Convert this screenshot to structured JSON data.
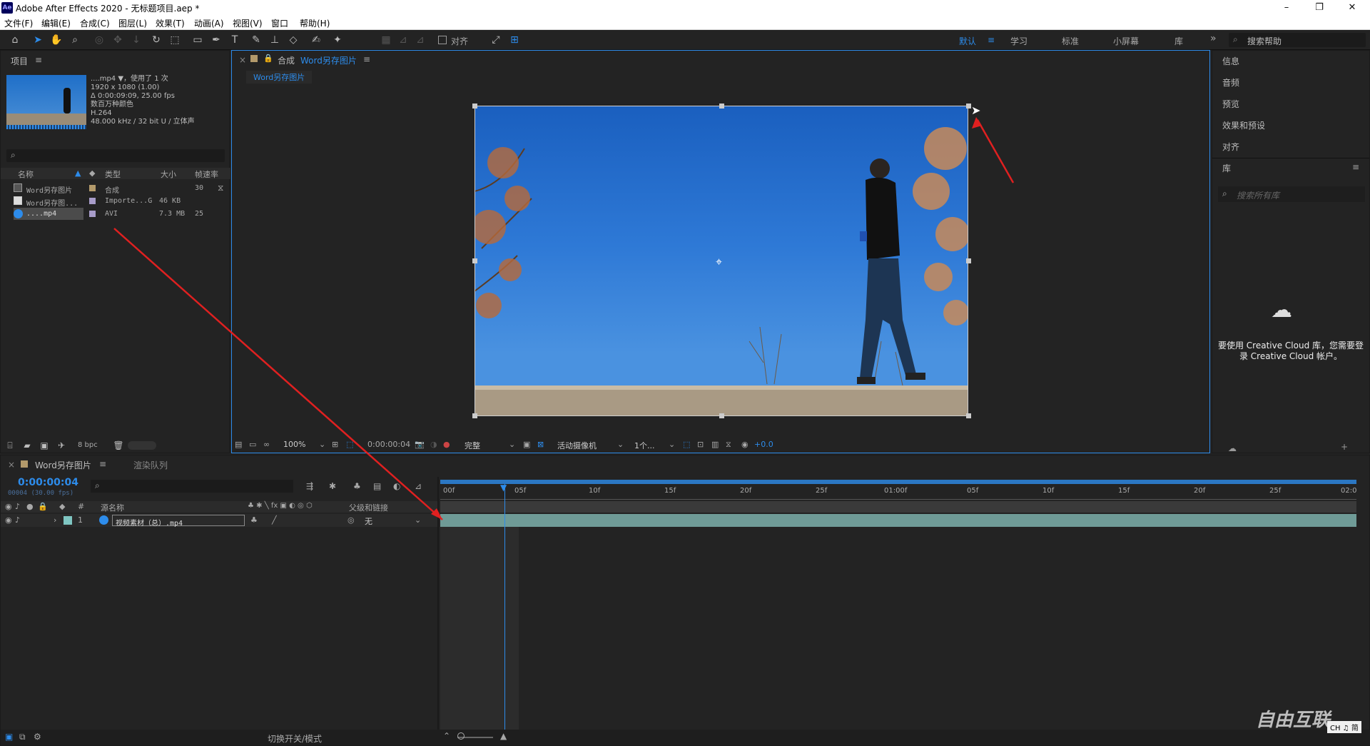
{
  "window": {
    "app_title": "Adobe After Effects 2020 - 无标题项目.aep *",
    "logo_text": "Ae",
    "minimize": "–",
    "restore": "❐",
    "close": "✕"
  },
  "menu": [
    "文件(F)",
    "编辑(E)",
    "合成(C)",
    "图层(L)",
    "效果(T)",
    "动画(A)",
    "视图(V)",
    "窗口",
    "帮助(H)"
  ],
  "toolbar": {
    "align_label": "对齐",
    "workspaces": [
      "默认",
      "学习",
      "标准",
      "小屏幕",
      "库"
    ],
    "active_workspace": "默认",
    "more": "»",
    "help_search_placeholder": "搜索帮助"
  },
  "project": {
    "tab_label": "项目",
    "menu_icon": "≡",
    "preview": {
      "name": "....mp4 ▼",
      "used": "，使用了 1 次",
      "dims": "1920 x 1080 (1.00)",
      "duration": "Δ 0:00:09:09, 25.00 fps",
      "colors": "数百万种颜色",
      "codec": "H.264",
      "audio": "48.000 kHz / 32 bit U / 立体声"
    },
    "search_placeholder": "",
    "columns": {
      "name": "名称",
      "type": "类型",
      "size": "大小",
      "fps": "帧速率"
    },
    "items": [
      {
        "name": "Word另存图片",
        "type": "合成",
        "size": "",
        "fps": "30",
        "color": "#b39a6b"
      },
      {
        "name": "Word另存图...",
        "type": "Importe...G",
        "size": "46 KB",
        "fps": "",
        "color": "#a79cc9"
      },
      {
        "name": "....mp4",
        "type": "AVI",
        "size": "7.3 MB",
        "fps": "25",
        "color": "#a79cc9"
      }
    ],
    "bpc": "8 bpc"
  },
  "composition": {
    "tab_prefix": "合成",
    "tab_name": "Word另存图片",
    "breadcrumb": "Word另存图片",
    "zoom": "100%",
    "timecode": "0:00:00:04",
    "quality": "完整",
    "camera": "活动摄像机",
    "views": "1个...",
    "exposure": "+0.0"
  },
  "right_panels": {
    "items": [
      "信息",
      "音频",
      "预览",
      "效果和预设",
      "对齐"
    ],
    "library_label": "库",
    "library_search_placeholder": "搜索所有库",
    "cc_message": "要使用 Creative Cloud 库，您需要登录 Creative Cloud 帐户。"
  },
  "timeline": {
    "tab_name": "Word另存图片",
    "render_queue": "渲染队列",
    "current_time": "0:00:00:04",
    "frame_info": "00004 (30.00 fps)",
    "columns": {
      "number": "#",
      "source": "源名称",
      "parent": "父级和链接"
    },
    "layers": [
      {
        "index": "1",
        "name": "视频素材（总）.mp4",
        "parent": "无"
      }
    ],
    "ruler_labels": [
      "00f",
      "05f",
      "10f",
      "15f",
      "20f",
      "25f",
      "01:00f",
      "05f",
      "10f",
      "15f",
      "20f",
      "25f",
      "02:0"
    ],
    "playhead_frame": 4,
    "toggle_label": "切换开关/模式"
  },
  "ime": "CH ♫ 简",
  "watermark": "自由互联"
}
